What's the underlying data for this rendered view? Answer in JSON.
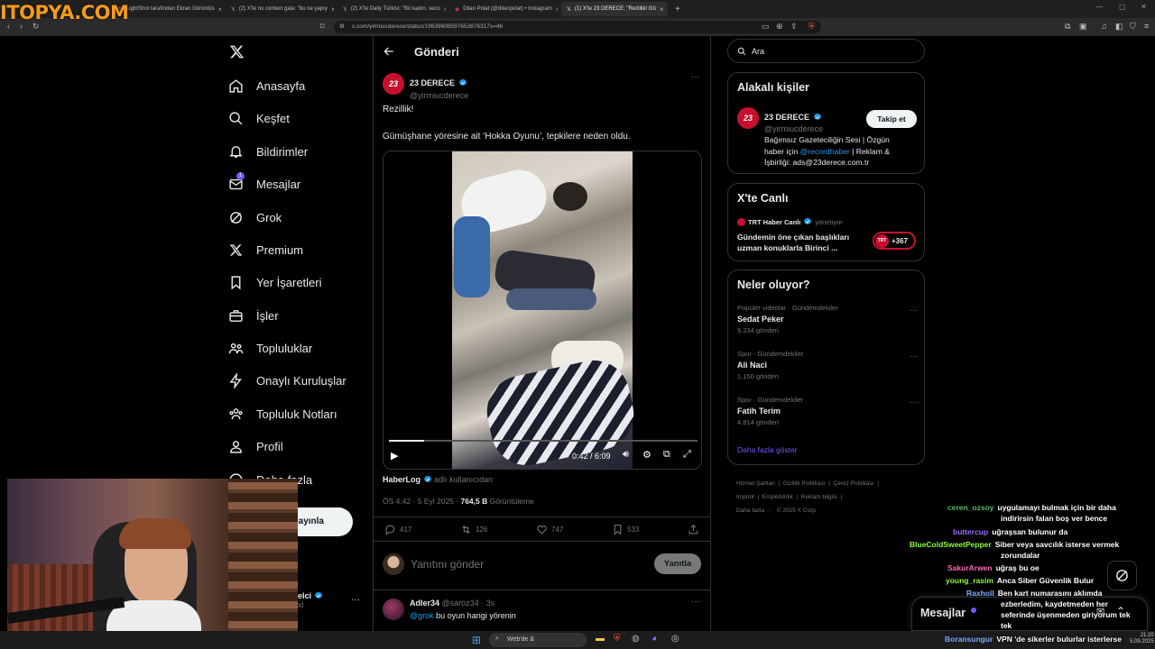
{
  "watermark": "ITOPYA.COM",
  "browser": {
    "tabs": [
      {
        "label": "LightShot tarafından Ekran Görüntüs"
      },
      {
        "label": "(2) X'te no context gala: \"bu ne yapıy"
      },
      {
        "label": "(2) X'te Daily Türkist: \"Bir kadın, sezo"
      },
      {
        "label": "Dilan Polat (@dilanpolat) • Instagram"
      },
      {
        "label": "(1) X'te 23 DERECE: \"Rezillik! Gü"
      }
    ],
    "url": "x.com/yirmiucderece/status/19639608597653876317s=46"
  },
  "nav": {
    "items": [
      {
        "label": "Anasayfa",
        "icon": "home-icon"
      },
      {
        "label": "Keşfet",
        "icon": "search-icon"
      },
      {
        "label": "Bildirimler",
        "icon": "bell-icon"
      },
      {
        "label": "Mesajlar",
        "icon": "mail-icon",
        "badge": "1"
      },
      {
        "label": "Grok",
        "icon": "grok-icon"
      },
      {
        "label": "Premium",
        "icon": "x-logo-icon"
      },
      {
        "label": "Yer İşaretleri",
        "icon": "bookmark-icon"
      },
      {
        "label": "İşler",
        "icon": "briefcase-icon"
      },
      {
        "label": "Topluluklar",
        "icon": "people-icon"
      },
      {
        "label": "Onaylı Kuruluşlar",
        "icon": "lightning-icon"
      },
      {
        "label": "Topluluk Notları",
        "icon": "community-notes-icon"
      },
      {
        "label": "Profil",
        "icon": "person-icon"
      },
      {
        "label": "Daha fazla",
        "icon": "more-icon"
      }
    ],
    "post_button": "ayınla",
    "account_name": "elci",
    "account_handle": "xi"
  },
  "header": {
    "title": "Gönderi"
  },
  "tweet": {
    "name": "23 DERECE",
    "handle": "@yirmiucderece",
    "text1": "Rezillik!",
    "text2": "Gümüşhane yöresine ait ‘Hokka Oyunu’, tepkilere neden oldu.",
    "video_time": "0:42 / 6:09",
    "video_progress": 0.114,
    "attribution_name": "HaberLog",
    "attribution_suffix": "adlı kullanıcıdan",
    "timestamp": "ÖS 4:42 · 5 Eyl 2025 · ",
    "views": "764,5 B",
    "views_label": " Görüntüleme",
    "stats": {
      "replies": "417",
      "retweets": "126",
      "likes": "747",
      "bookmarks": "533"
    }
  },
  "reply_box": {
    "placeholder": "Yanıtını gönder",
    "button": "Yanıtla"
  },
  "reply": {
    "name": "Adler34",
    "meta": "@saroz34 · 3s",
    "mention": "@grok",
    "text": " bu oyun hangi yörenin"
  },
  "search": {
    "placeholder": "Ara"
  },
  "related": {
    "title": "Alakalı kişiler",
    "name": "23 DERECE",
    "handle": "@yirmiucderece",
    "follow": "Takip et",
    "bio1": "Bağımsız Gazeteciliğin Sesi | Özgün",
    "bio2": "haber için ",
    "bio_link": "@recordhaber",
    "bio3": " | Reklam &",
    "bio4": "İşbirliği: ads@23derece.com.tr"
  },
  "live": {
    "title": "X'te Canlı",
    "host": "TRT Haber Canlı",
    "host_role": "yönetiyor",
    "line1": "Gündemin öne çıkan başlıkları",
    "line2": "uzman konuklarla Birinci ...",
    "count": "+367"
  },
  "trends": {
    "title": "Neler oluyor?",
    "items": [
      {
        "context": "Popüler videolar · Gündemdekiler",
        "topic": "Sedat Peker",
        "count": "9.234 gönderi"
      },
      {
        "context": "Spor · Gündemdekiler",
        "topic": "Ali Naci",
        "count": "1.150 gönderi"
      },
      {
        "context": "Spor · Gündemdekiler",
        "topic": "Fatih Terim",
        "count": "4.814 gönderi"
      }
    ],
    "show_more": "Daha fazla göster"
  },
  "footer": {
    "links1": [
      "Hizmet Şartları",
      "Gizlilik Politikası",
      "Çerez Politikası"
    ],
    "links2": [
      "Imprint",
      "Erişilebilirlik",
      "Reklam bilgisi"
    ],
    "links3": "Daha fazla ···",
    "copyright": "© 2025 X Corp."
  },
  "messages_drawer": {
    "label": "Mesajlar"
  },
  "chat": [
    {
      "user": "ceren_ozsoy",
      "color": "#5fb760",
      "msg": "uygulamayı bulmak için bir daha",
      "msg2": "indirirsin falan boş ver bence"
    },
    {
      "user": "buttercup",
      "color": "#9b6bff",
      "msg": "uğraşsan bulunur da"
    },
    {
      "user": "BlueColdSweetPepper",
      "color": "#8dfc3a",
      "msg": "Siber veya savcılık isterse vermek",
      "msg2": "zorundalar"
    },
    {
      "user": "SakurArwen",
      "color": "#ff69b4",
      "msg": "uğraş bu oe"
    },
    {
      "user": "young_rasim",
      "color": "#8dfc3a",
      "msg": "Anca Siber Güvenlik Bulur"
    },
    {
      "user": "Raxholl",
      "color": "#7aa8ff",
      "msg": "Ben kart numarasını aklımda",
      "msg2": "ezberledim, kaydetmeden her",
      "msg3": "seferinde üşenmeden giriyorum tek",
      "msg4": "tek"
    },
    {
      "user": "Boransungur",
      "color": "#7aa8ff",
      "msg": "VPN 'de sikerler bulurlar isterlerse"
    }
  ],
  "taskbar": {
    "search": "Web'de &",
    "time": "21:20",
    "date": "5.09.2025"
  }
}
